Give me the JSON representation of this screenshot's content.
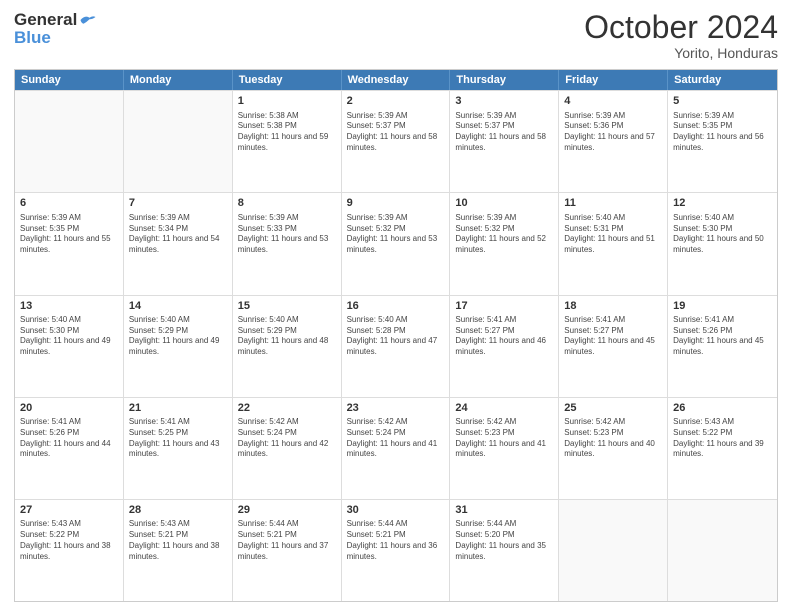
{
  "header": {
    "logo_line1": "General",
    "logo_line2": "Blue",
    "month": "October 2024",
    "location": "Yorito, Honduras"
  },
  "days_of_week": [
    "Sunday",
    "Monday",
    "Tuesday",
    "Wednesday",
    "Thursday",
    "Friday",
    "Saturday"
  ],
  "weeks": [
    [
      {
        "day": "",
        "sunrise": "",
        "sunset": "",
        "daylight": ""
      },
      {
        "day": "",
        "sunrise": "",
        "sunset": "",
        "daylight": ""
      },
      {
        "day": "1",
        "sunrise": "Sunrise: 5:38 AM",
        "sunset": "Sunset: 5:38 PM",
        "daylight": "Daylight: 11 hours and 59 minutes."
      },
      {
        "day": "2",
        "sunrise": "Sunrise: 5:39 AM",
        "sunset": "Sunset: 5:37 PM",
        "daylight": "Daylight: 11 hours and 58 minutes."
      },
      {
        "day": "3",
        "sunrise": "Sunrise: 5:39 AM",
        "sunset": "Sunset: 5:37 PM",
        "daylight": "Daylight: 11 hours and 58 minutes."
      },
      {
        "day": "4",
        "sunrise": "Sunrise: 5:39 AM",
        "sunset": "Sunset: 5:36 PM",
        "daylight": "Daylight: 11 hours and 57 minutes."
      },
      {
        "day": "5",
        "sunrise": "Sunrise: 5:39 AM",
        "sunset": "Sunset: 5:35 PM",
        "daylight": "Daylight: 11 hours and 56 minutes."
      }
    ],
    [
      {
        "day": "6",
        "sunrise": "Sunrise: 5:39 AM",
        "sunset": "Sunset: 5:35 PM",
        "daylight": "Daylight: 11 hours and 55 minutes."
      },
      {
        "day": "7",
        "sunrise": "Sunrise: 5:39 AM",
        "sunset": "Sunset: 5:34 PM",
        "daylight": "Daylight: 11 hours and 54 minutes."
      },
      {
        "day": "8",
        "sunrise": "Sunrise: 5:39 AM",
        "sunset": "Sunset: 5:33 PM",
        "daylight": "Daylight: 11 hours and 53 minutes."
      },
      {
        "day": "9",
        "sunrise": "Sunrise: 5:39 AM",
        "sunset": "Sunset: 5:32 PM",
        "daylight": "Daylight: 11 hours and 53 minutes."
      },
      {
        "day": "10",
        "sunrise": "Sunrise: 5:39 AM",
        "sunset": "Sunset: 5:32 PM",
        "daylight": "Daylight: 11 hours and 52 minutes."
      },
      {
        "day": "11",
        "sunrise": "Sunrise: 5:40 AM",
        "sunset": "Sunset: 5:31 PM",
        "daylight": "Daylight: 11 hours and 51 minutes."
      },
      {
        "day": "12",
        "sunrise": "Sunrise: 5:40 AM",
        "sunset": "Sunset: 5:30 PM",
        "daylight": "Daylight: 11 hours and 50 minutes."
      }
    ],
    [
      {
        "day": "13",
        "sunrise": "Sunrise: 5:40 AM",
        "sunset": "Sunset: 5:30 PM",
        "daylight": "Daylight: 11 hours and 49 minutes."
      },
      {
        "day": "14",
        "sunrise": "Sunrise: 5:40 AM",
        "sunset": "Sunset: 5:29 PM",
        "daylight": "Daylight: 11 hours and 49 minutes."
      },
      {
        "day": "15",
        "sunrise": "Sunrise: 5:40 AM",
        "sunset": "Sunset: 5:29 PM",
        "daylight": "Daylight: 11 hours and 48 minutes."
      },
      {
        "day": "16",
        "sunrise": "Sunrise: 5:40 AM",
        "sunset": "Sunset: 5:28 PM",
        "daylight": "Daylight: 11 hours and 47 minutes."
      },
      {
        "day": "17",
        "sunrise": "Sunrise: 5:41 AM",
        "sunset": "Sunset: 5:27 PM",
        "daylight": "Daylight: 11 hours and 46 minutes."
      },
      {
        "day": "18",
        "sunrise": "Sunrise: 5:41 AM",
        "sunset": "Sunset: 5:27 PM",
        "daylight": "Daylight: 11 hours and 45 minutes."
      },
      {
        "day": "19",
        "sunrise": "Sunrise: 5:41 AM",
        "sunset": "Sunset: 5:26 PM",
        "daylight": "Daylight: 11 hours and 45 minutes."
      }
    ],
    [
      {
        "day": "20",
        "sunrise": "Sunrise: 5:41 AM",
        "sunset": "Sunset: 5:26 PM",
        "daylight": "Daylight: 11 hours and 44 minutes."
      },
      {
        "day": "21",
        "sunrise": "Sunrise: 5:41 AM",
        "sunset": "Sunset: 5:25 PM",
        "daylight": "Daylight: 11 hours and 43 minutes."
      },
      {
        "day": "22",
        "sunrise": "Sunrise: 5:42 AM",
        "sunset": "Sunset: 5:24 PM",
        "daylight": "Daylight: 11 hours and 42 minutes."
      },
      {
        "day": "23",
        "sunrise": "Sunrise: 5:42 AM",
        "sunset": "Sunset: 5:24 PM",
        "daylight": "Daylight: 11 hours and 41 minutes."
      },
      {
        "day": "24",
        "sunrise": "Sunrise: 5:42 AM",
        "sunset": "Sunset: 5:23 PM",
        "daylight": "Daylight: 11 hours and 41 minutes."
      },
      {
        "day": "25",
        "sunrise": "Sunrise: 5:42 AM",
        "sunset": "Sunset: 5:23 PM",
        "daylight": "Daylight: 11 hours and 40 minutes."
      },
      {
        "day": "26",
        "sunrise": "Sunrise: 5:43 AM",
        "sunset": "Sunset: 5:22 PM",
        "daylight": "Daylight: 11 hours and 39 minutes."
      }
    ],
    [
      {
        "day": "27",
        "sunrise": "Sunrise: 5:43 AM",
        "sunset": "Sunset: 5:22 PM",
        "daylight": "Daylight: 11 hours and 38 minutes."
      },
      {
        "day": "28",
        "sunrise": "Sunrise: 5:43 AM",
        "sunset": "Sunset: 5:21 PM",
        "daylight": "Daylight: 11 hours and 38 minutes."
      },
      {
        "day": "29",
        "sunrise": "Sunrise: 5:44 AM",
        "sunset": "Sunset: 5:21 PM",
        "daylight": "Daylight: 11 hours and 37 minutes."
      },
      {
        "day": "30",
        "sunrise": "Sunrise: 5:44 AM",
        "sunset": "Sunset: 5:21 PM",
        "daylight": "Daylight: 11 hours and 36 minutes."
      },
      {
        "day": "31",
        "sunrise": "Sunrise: 5:44 AM",
        "sunset": "Sunset: 5:20 PM",
        "daylight": "Daylight: 11 hours and 35 minutes."
      },
      {
        "day": "",
        "sunrise": "",
        "sunset": "",
        "daylight": ""
      },
      {
        "day": "",
        "sunrise": "",
        "sunset": "",
        "daylight": ""
      }
    ]
  ]
}
